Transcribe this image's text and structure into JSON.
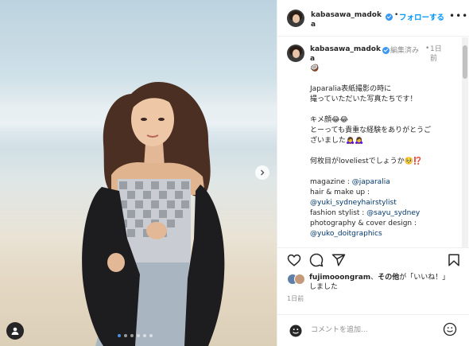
{
  "header": {
    "username": "kabasawa_madoka",
    "separator": "•",
    "follow_label": "フォローする",
    "more_icon": "more-horizontal-icon"
  },
  "caption": {
    "username": "kabasawa_madoka",
    "edited_label": "編集済み",
    "separator": "•",
    "time": "1日前",
    "lines": [
      "🥥",
      "",
      "Japaralia表紙撮影の時に",
      "撮っていただいた写真たちです！",
      "",
      "キメ顔😂😂",
      "とーっても貴重な経験をありがとうご",
      "ざいました🙇‍♀️🙇‍♀️",
      "",
      "何枚目がloveliestでしょうか🥺⁉️",
      ""
    ],
    "credits": [
      {
        "label": "magazine : ",
        "handle": "@japaralia"
      },
      {
        "label": "hair & make up : ",
        "handle": ""
      },
      {
        "label": "",
        "handle": "@yuki_sydneyhairstylist"
      },
      {
        "label": "fashion stylist : ",
        "handle": "@sayu_sydney"
      },
      {
        "label": "photography & cover design : ",
        "handle": ""
      },
      {
        "label": "",
        "handle": "@yuko_doitgraphics"
      }
    ]
  },
  "actions": {
    "like_icon": "heart-icon",
    "comment_icon": "comment-icon",
    "share_icon": "share-icon",
    "save_icon": "bookmark-icon"
  },
  "likes": {
    "user": "fujimooongram",
    "others_label": "その他",
    "suffix": "が「いいね！」",
    "suffix2": "しました"
  },
  "post_time": "1日前",
  "comment": {
    "placeholder": "コメントを追加..."
  },
  "carousel": {
    "dot_count": 6,
    "active_index": 0
  },
  "colors": {
    "link": "#00376b",
    "follow": "#0095f6",
    "verified": "#3897f0",
    "muted": "#8e8e8e"
  }
}
